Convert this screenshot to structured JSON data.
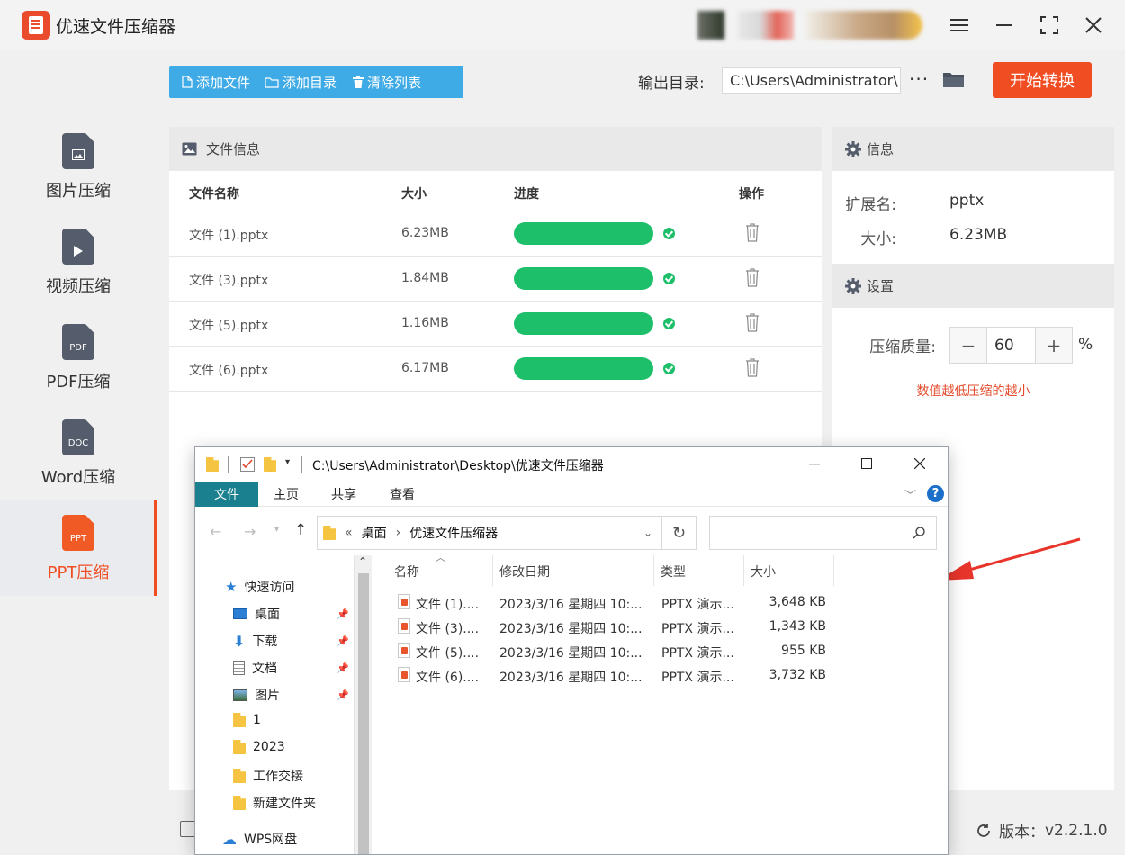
{
  "app": {
    "title": "优速文件压缩器",
    "version_label": "版本：",
    "version": "v2.2.1.0",
    "accent_color": "#f04d23",
    "toolbar_color": "#3eaae6",
    "progress_color": "#1dbf6a"
  },
  "sidebar": {
    "items": [
      {
        "label": "图片压缩",
        "icon": "image-file-icon",
        "badge": ""
      },
      {
        "label": "视频压缩",
        "icon": "video-file-icon",
        "badge": ""
      },
      {
        "label": "PDF压缩",
        "icon": "pdf-file-icon",
        "badge": "PDF"
      },
      {
        "label": "Word压缩",
        "icon": "doc-file-icon",
        "badge": "DOC"
      },
      {
        "label": "PPT压缩",
        "icon": "ppt-file-icon",
        "badge": "PPT",
        "active": true
      }
    ]
  },
  "toolbar": {
    "add_file": "添加文件",
    "add_folder": "添加目录",
    "clear_list": "清除列表",
    "output_label": "输出目录:",
    "output_path": "C:\\Users\\Administrator\\",
    "more": "···",
    "start": "开始转换"
  },
  "file_panel": {
    "title": "文件信息",
    "columns": [
      "文件名称",
      "大小",
      "进度",
      "操作"
    ],
    "rows": [
      {
        "name": "文件 (1).pptx",
        "size": "6.23MB",
        "progress": 1.0
      },
      {
        "name": "文件 (3).pptx",
        "size": "1.84MB",
        "progress": 1.0
      },
      {
        "name": "文件 (5).pptx",
        "size": "1.16MB",
        "progress": 1.0
      },
      {
        "name": "文件 (6).pptx",
        "size": "6.17MB",
        "progress": 1.0
      }
    ]
  },
  "info_panel": {
    "title": "信息",
    "ext_label": "扩展名:",
    "ext_value": "pptx",
    "size_label": "大小:",
    "size_value": "6.23MB",
    "settings_title": "设置",
    "quality_label": "压缩质量:",
    "quality_value": "60",
    "quality_unit": "%",
    "minus": "−",
    "plus": "+",
    "hint": "数值越低压缩的越小"
  },
  "explorer": {
    "path_title": "C:\\Users\\Administrator\\Desktop\\优速文件压缩器",
    "tabs": [
      "文件",
      "主页",
      "共享",
      "查看"
    ],
    "breadcrumb": [
      "桌面",
      "优速文件压缩器"
    ],
    "breadcrumb_prefix": "«",
    "nav": [
      {
        "label": "快速访问",
        "icon": "star-icon"
      },
      {
        "label": "桌面",
        "icon": "desktop-icon",
        "pinned": true
      },
      {
        "label": "下载",
        "icon": "download-icon",
        "pinned": true
      },
      {
        "label": "文档",
        "icon": "document-icon",
        "pinned": true
      },
      {
        "label": "图片",
        "icon": "picture-icon",
        "pinned": true
      },
      {
        "label": "1",
        "icon": "folder-icon"
      },
      {
        "label": "2023",
        "icon": "folder-icon"
      },
      {
        "label": "工作交接",
        "icon": "folder-icon"
      },
      {
        "label": "新建文件夹",
        "icon": "folder-icon"
      },
      {
        "label": "WPS网盘",
        "icon": "cloud-icon"
      }
    ],
    "columns": [
      "名称",
      "修改日期",
      "类型",
      "大小"
    ],
    "files": [
      {
        "name": "文件 (1)....",
        "date": "2023/3/16 星期四 10:...",
        "type": "PPTX 演示...",
        "size": "3,648 KB"
      },
      {
        "name": "文件 (3)....",
        "date": "2023/3/16 星期四 10:...",
        "type": "PPTX 演示...",
        "size": "1,343 KB"
      },
      {
        "name": "文件 (5)....",
        "date": "2023/3/16 星期四 10:...",
        "type": "PPTX 演示...",
        "size": "955 KB"
      },
      {
        "name": "文件 (6)....",
        "date": "2023/3/16 星期四 10:...",
        "type": "PPTX 演示...",
        "size": "3,732 KB"
      }
    ]
  }
}
